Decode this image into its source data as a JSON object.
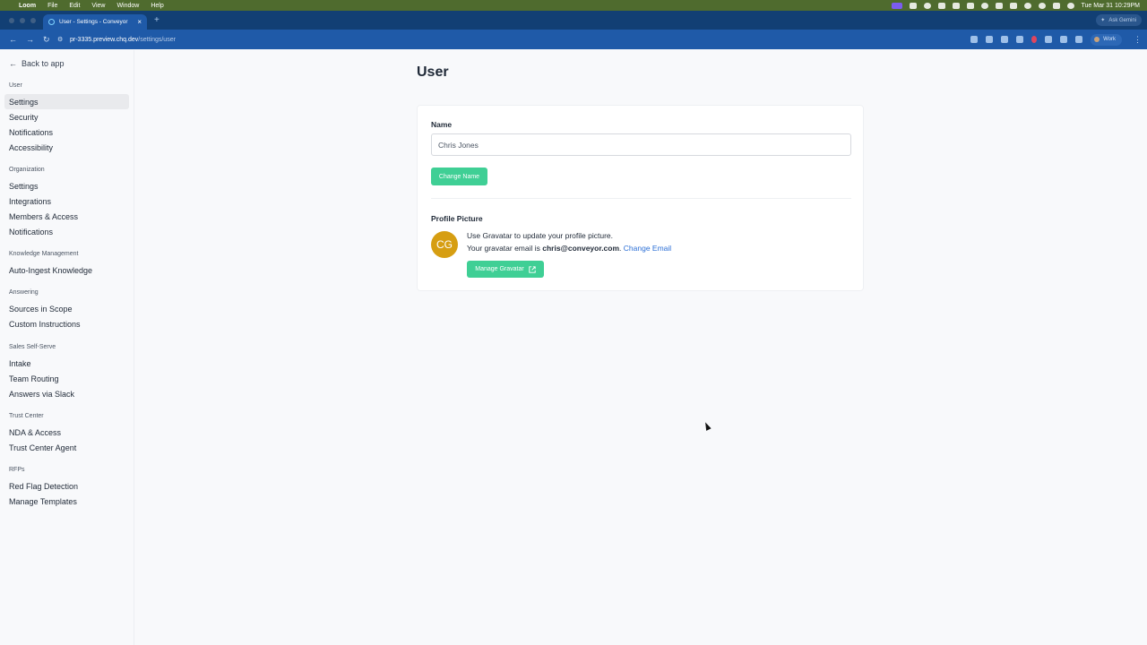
{
  "menubar": {
    "app": "Loom",
    "items": [
      "File",
      "Edit",
      "View",
      "Window",
      "Help"
    ],
    "datetime": "Tue Mar 31  10:29PM"
  },
  "browser": {
    "tab_title": "User - Settings - Conveyor",
    "ask_gemini": "Ask Gemini",
    "url_host": "pr-3335.preview.chq.dev",
    "url_path": "/settings/user",
    "profile_label": "Work"
  },
  "sidebar": {
    "back_label": "Back to app",
    "sections": [
      {
        "label": "User",
        "items": [
          "Settings",
          "Security",
          "Notifications",
          "Accessibility"
        ]
      },
      {
        "label": "Organization",
        "items": [
          "Settings",
          "Integrations",
          "Members & Access",
          "Notifications"
        ]
      },
      {
        "label": "Knowledge Management",
        "items": [
          "Auto-Ingest Knowledge"
        ]
      },
      {
        "label": "Answering",
        "items": [
          "Sources in Scope",
          "Custom Instructions"
        ]
      },
      {
        "label": "Sales Self-Serve",
        "items": [
          "Intake",
          "Team Routing",
          "Answers via Slack"
        ]
      },
      {
        "label": "Trust Center",
        "items": [
          "NDA & Access",
          "Trust Center Agent"
        ]
      },
      {
        "label": "RFPs",
        "items": [
          "Red Flag Detection",
          "Manage Templates"
        ]
      }
    ],
    "active": "Settings"
  },
  "main": {
    "title": "User",
    "name_label": "Name",
    "name_value": "Chris Jones",
    "change_name_button": "Change Name",
    "profile_picture_label": "Profile Picture",
    "avatar_initials": "CG",
    "gravatar_line1": "Use Gravatar to update your profile picture.",
    "gravatar_line2_prefix": "Your gravatar email is ",
    "gravatar_email": "chris@conveyor.com",
    "gravatar_line2_suffix": ".",
    "change_email_link": "Change Email",
    "manage_gravatar_button": "Manage Gravatar"
  },
  "colors": {
    "accent_green": "#3fcf95",
    "avatar_bg": "#d69e12",
    "link_blue": "#2b6fd6"
  }
}
